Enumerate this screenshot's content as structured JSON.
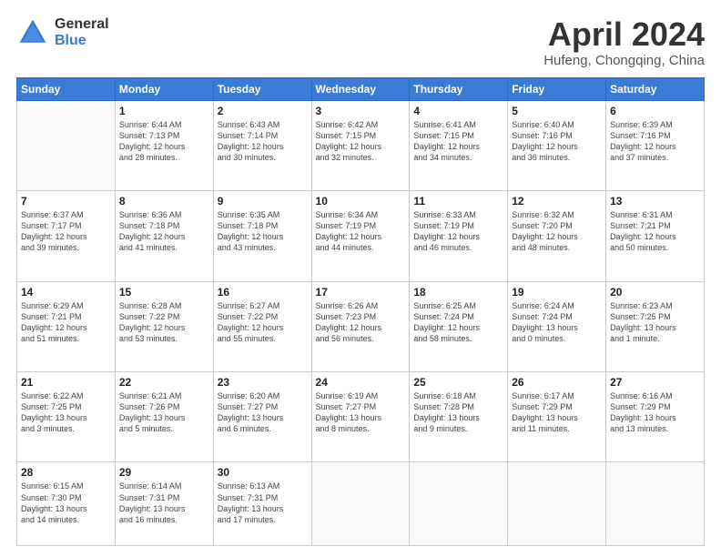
{
  "header": {
    "logo_general": "General",
    "logo_blue": "Blue",
    "month_title": "April 2024",
    "subtitle": "Hufeng, Chongqing, China"
  },
  "days_of_week": [
    "Sunday",
    "Monday",
    "Tuesday",
    "Wednesday",
    "Thursday",
    "Friday",
    "Saturday"
  ],
  "weeks": [
    [
      {
        "day": "",
        "content": ""
      },
      {
        "day": "1",
        "content": "Sunrise: 6:44 AM\nSunset: 7:13 PM\nDaylight: 12 hours\nand 28 minutes."
      },
      {
        "day": "2",
        "content": "Sunrise: 6:43 AM\nSunset: 7:14 PM\nDaylight: 12 hours\nand 30 minutes."
      },
      {
        "day": "3",
        "content": "Sunrise: 6:42 AM\nSunset: 7:15 PM\nDaylight: 12 hours\nand 32 minutes."
      },
      {
        "day": "4",
        "content": "Sunrise: 6:41 AM\nSunset: 7:15 PM\nDaylight: 12 hours\nand 34 minutes."
      },
      {
        "day": "5",
        "content": "Sunrise: 6:40 AM\nSunset: 7:16 PM\nDaylight: 12 hours\nand 36 minutes."
      },
      {
        "day": "6",
        "content": "Sunrise: 6:39 AM\nSunset: 7:16 PM\nDaylight: 12 hours\nand 37 minutes."
      }
    ],
    [
      {
        "day": "7",
        "content": "Sunrise: 6:37 AM\nSunset: 7:17 PM\nDaylight: 12 hours\nand 39 minutes."
      },
      {
        "day": "8",
        "content": "Sunrise: 6:36 AM\nSunset: 7:18 PM\nDaylight: 12 hours\nand 41 minutes."
      },
      {
        "day": "9",
        "content": "Sunrise: 6:35 AM\nSunset: 7:18 PM\nDaylight: 12 hours\nand 43 minutes."
      },
      {
        "day": "10",
        "content": "Sunrise: 6:34 AM\nSunset: 7:19 PM\nDaylight: 12 hours\nand 44 minutes."
      },
      {
        "day": "11",
        "content": "Sunrise: 6:33 AM\nSunset: 7:19 PM\nDaylight: 12 hours\nand 46 minutes."
      },
      {
        "day": "12",
        "content": "Sunrise: 6:32 AM\nSunset: 7:20 PM\nDaylight: 12 hours\nand 48 minutes."
      },
      {
        "day": "13",
        "content": "Sunrise: 6:31 AM\nSunset: 7:21 PM\nDaylight: 12 hours\nand 50 minutes."
      }
    ],
    [
      {
        "day": "14",
        "content": "Sunrise: 6:29 AM\nSunset: 7:21 PM\nDaylight: 12 hours\nand 51 minutes."
      },
      {
        "day": "15",
        "content": "Sunrise: 6:28 AM\nSunset: 7:22 PM\nDaylight: 12 hours\nand 53 minutes."
      },
      {
        "day": "16",
        "content": "Sunrise: 6:27 AM\nSunset: 7:22 PM\nDaylight: 12 hours\nand 55 minutes."
      },
      {
        "day": "17",
        "content": "Sunrise: 6:26 AM\nSunset: 7:23 PM\nDaylight: 12 hours\nand 56 minutes."
      },
      {
        "day": "18",
        "content": "Sunrise: 6:25 AM\nSunset: 7:24 PM\nDaylight: 12 hours\nand 58 minutes."
      },
      {
        "day": "19",
        "content": "Sunrise: 6:24 AM\nSunset: 7:24 PM\nDaylight: 13 hours\nand 0 minutes."
      },
      {
        "day": "20",
        "content": "Sunrise: 6:23 AM\nSunset: 7:25 PM\nDaylight: 13 hours\nand 1 minute."
      }
    ],
    [
      {
        "day": "21",
        "content": "Sunrise: 6:22 AM\nSunset: 7:25 PM\nDaylight: 13 hours\nand 3 minutes."
      },
      {
        "day": "22",
        "content": "Sunrise: 6:21 AM\nSunset: 7:26 PM\nDaylight: 13 hours\nand 5 minutes."
      },
      {
        "day": "23",
        "content": "Sunrise: 6:20 AM\nSunset: 7:27 PM\nDaylight: 13 hours\nand 6 minutes."
      },
      {
        "day": "24",
        "content": "Sunrise: 6:19 AM\nSunset: 7:27 PM\nDaylight: 13 hours\nand 8 minutes."
      },
      {
        "day": "25",
        "content": "Sunrise: 6:18 AM\nSunset: 7:28 PM\nDaylight: 13 hours\nand 9 minutes."
      },
      {
        "day": "26",
        "content": "Sunrise: 6:17 AM\nSunset: 7:29 PM\nDaylight: 13 hours\nand 11 minutes."
      },
      {
        "day": "27",
        "content": "Sunrise: 6:16 AM\nSunset: 7:29 PM\nDaylight: 13 hours\nand 13 minutes."
      }
    ],
    [
      {
        "day": "28",
        "content": "Sunrise: 6:15 AM\nSunset: 7:30 PM\nDaylight: 13 hours\nand 14 minutes."
      },
      {
        "day": "29",
        "content": "Sunrise: 6:14 AM\nSunset: 7:31 PM\nDaylight: 13 hours\nand 16 minutes."
      },
      {
        "day": "30",
        "content": "Sunrise: 6:13 AM\nSunset: 7:31 PM\nDaylight: 13 hours\nand 17 minutes."
      },
      {
        "day": "",
        "content": ""
      },
      {
        "day": "",
        "content": ""
      },
      {
        "day": "",
        "content": ""
      },
      {
        "day": "",
        "content": ""
      }
    ]
  ]
}
